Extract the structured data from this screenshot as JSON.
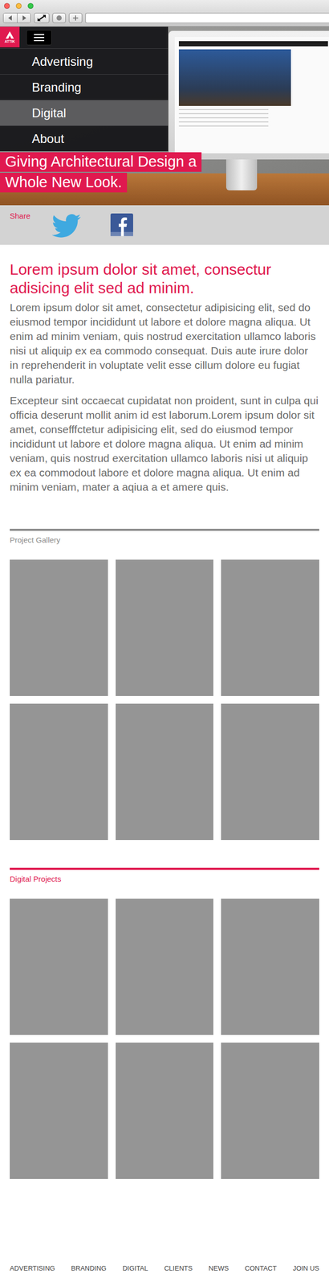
{
  "logo": {
    "text": "ATTIK"
  },
  "menu": {
    "open": true,
    "items": [
      {
        "label": "Advertising",
        "selected": false
      },
      {
        "label": "Branding",
        "selected": false
      },
      {
        "label": "Digital",
        "selected": true
      },
      {
        "label": "About",
        "selected": false
      }
    ]
  },
  "hero": {
    "title": "Giving Architectural Design a Whole New Look."
  },
  "share": {
    "label": "Share"
  },
  "article": {
    "heading": "Lorem ipsum dolor sit amet, consectur adisicing elit sed ad minim.",
    "paragraphs": [
      "Lorem ipsum dolor sit amet, consectetur adipisicing elit, sed do eiusmod tempor incididunt ut labore et dolore magna aliqua. Ut enim ad minim veniam, quis nostrud exercitation ullamco laboris nisi ut aliquip ex ea commodo consequat. Duis aute irure dolor in reprehenderit in voluptate velit esse cillum dolore eu fugiat nulla pariatur.",
      "Excepteur sint occaecat cupidatat non proident, sunt in culpa qui officia deserunt mollit anim id est laborum.Lorem ipsum dolor sit amet, consefffctetur adipisicing elit, sed do eiusmod tempor incididunt ut labore et dolore magna aliqua. Ut enim ad minim veniam, quis nostrud exercitation ullamco laboris nisi ut aliquip ex ea commodout labore et dolore magna aliqua. Ut enim ad minim veniam, mater a aqiua a et amere quis."
    ]
  },
  "sections": [
    {
      "title": "Project Gallery",
      "color": "#8c8c8c",
      "tiles": 6
    },
    {
      "title": "Digital Projects",
      "color": "#e0194f",
      "tiles": 6
    }
  ],
  "footer": {
    "links": [
      "ADVERTISING",
      "BRANDING",
      "DIGITAL",
      "CLIENTS",
      "NEWS",
      "CONTACT",
      "JOIN US"
    ]
  }
}
